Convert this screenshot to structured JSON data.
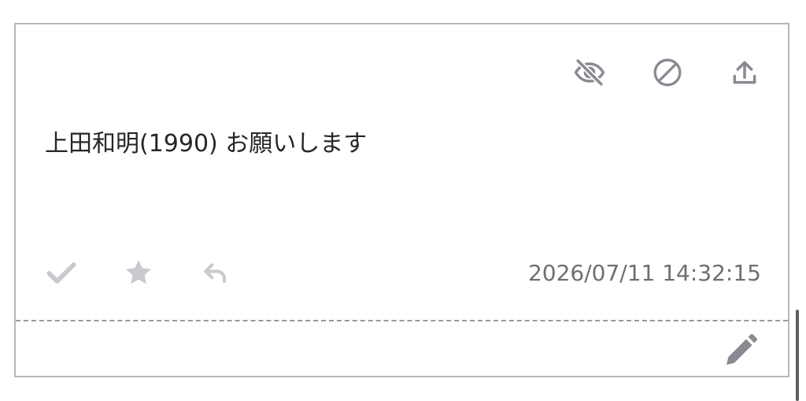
{
  "message": {
    "text": "上田和明(1990) お願いします",
    "timestamp": "2026/07/11 14:32:15"
  },
  "colors": {
    "border": "#b7b6c0",
    "icon_dark": "#8a8a92",
    "icon_light": "#c9c9cf",
    "text": "#262626",
    "timestamp": "#6f6f6f",
    "divider": "#9a9a9a"
  },
  "icons": {
    "top": [
      "eye-off-icon",
      "block-icon",
      "upload-icon"
    ],
    "bottom": [
      "check-icon",
      "star-icon",
      "reply-icon"
    ],
    "footer": [
      "pencil-icon"
    ]
  }
}
